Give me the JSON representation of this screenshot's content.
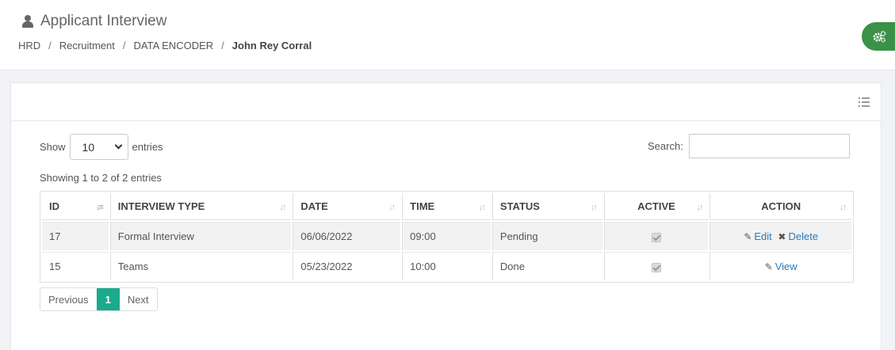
{
  "header": {
    "title": "Applicant Interview",
    "breadcrumb": [
      "HRD",
      "Recruitment",
      "DATA ENCODER",
      "John Rey Corral"
    ]
  },
  "table_controls": {
    "show_label": "Show",
    "entries_value": "10",
    "entries_label": "entries",
    "search_label": "Search:",
    "search_value": "",
    "info": "Showing 1 to 2 of 2 entries"
  },
  "columns": [
    "ID",
    "INTERVIEW TYPE",
    "DATE",
    "TIME",
    "STATUS",
    "ACTIVE",
    "ACTION"
  ],
  "rows": [
    {
      "id": "17",
      "type": "Formal Interview",
      "date": "06/06/2022",
      "time": "09:00",
      "status": "Pending",
      "active": true,
      "actions": [
        "Edit",
        "Delete"
      ]
    },
    {
      "id": "15",
      "type": "Teams",
      "date": "05/23/2022",
      "time": "10:00",
      "status": "Done",
      "active": true,
      "actions": [
        "View"
      ]
    }
  ],
  "pagination": {
    "previous": "Previous",
    "page": "1",
    "next": "Next"
  },
  "icons": {
    "user": "user-icon",
    "settings": "cogs-icon",
    "list": "list-icon",
    "edit": "edit-icon",
    "delete": "times-icon"
  },
  "colors": {
    "accent_green": "#3a9147",
    "pager_active": "#1aaa8c",
    "link": "#2a7ab8"
  }
}
